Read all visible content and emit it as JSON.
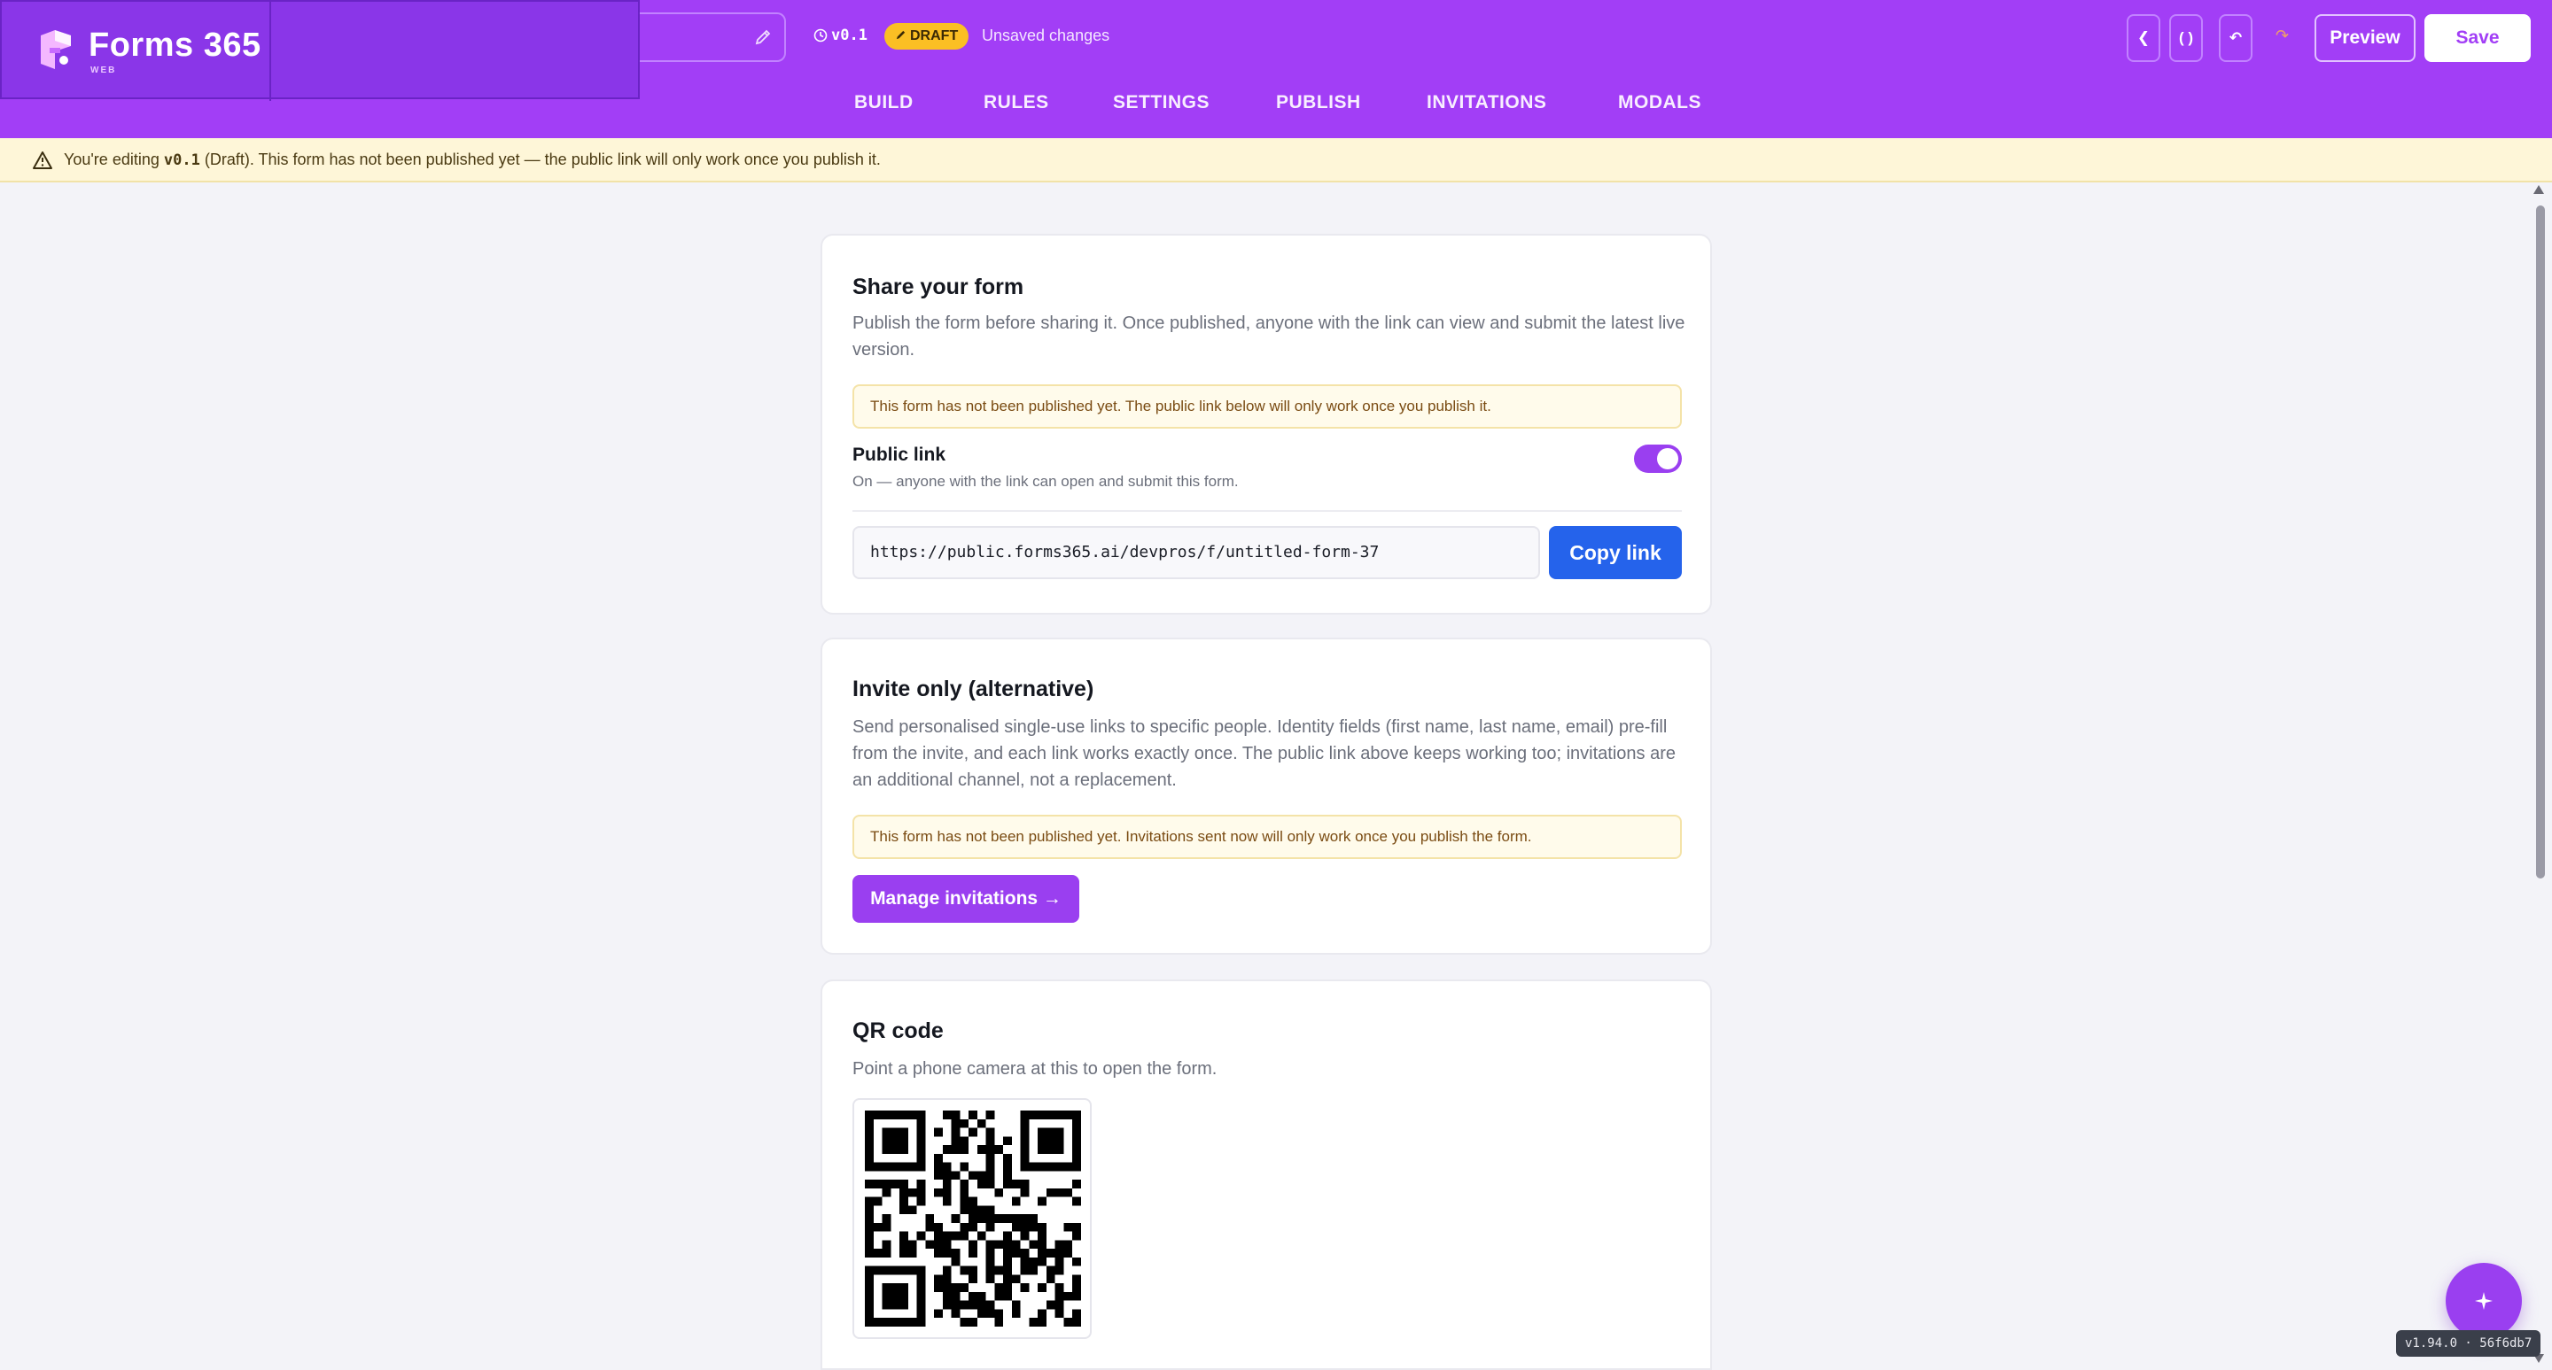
{
  "app": {
    "name": "Forms 365",
    "sub": "WEB"
  },
  "header": {
    "version": "v0.1",
    "draft_badge": "DRAFT",
    "unsaved": "Unsaved changes",
    "icon_buttons": [
      "❮",
      "( )",
      "↶"
    ],
    "redo": "↷",
    "preview_label": "Preview",
    "save_label": "Save"
  },
  "tabs": [
    {
      "label": "BUILD"
    },
    {
      "label": "RULES"
    },
    {
      "label": "SETTINGS"
    },
    {
      "label": "PUBLISH"
    },
    {
      "label": "INVITATIONS"
    },
    {
      "label": "MODALS"
    }
  ],
  "banner": {
    "prefix": "You're editing ",
    "version": "v0.1",
    "suffix": " (Draft). This form has not been published yet — the public link will only work once you publish it."
  },
  "share": {
    "title": "Share your form",
    "desc": "Publish the form before sharing it. Once published, anyone with the link can view and submit the latest live version.",
    "notice": "This form has not been published yet. The public link below will only work once you publish it.",
    "public_link_label": "Public link",
    "public_link_sub": "On — anyone with the link can open and submit this form.",
    "toggle_on": true,
    "url": "https://public.forms365.ai/devpros/f/untitled-form-37",
    "copy_label": "Copy link"
  },
  "invite": {
    "title": "Invite only (alternative)",
    "desc": "Send personalised single-use links to specific people. Identity fields (first name, last name, email) pre-fill from the invite, and each link works exactly once. The public link above keeps working too; invitations are an additional channel, not a replacement.",
    "notice": "This form has not been published yet. Invitations sent now will only work once you publish the form.",
    "manage_label": "Manage invitations →"
  },
  "qr": {
    "title": "QR code",
    "desc": "Point a phone camera at this to open the form."
  },
  "build_tag": "v1.94.0 · 56f6db7",
  "colors": {
    "brand": "#a23ef6",
    "accent_blue": "#2563eb",
    "draft": "#fbbf24",
    "banner": "#fef6d8"
  }
}
